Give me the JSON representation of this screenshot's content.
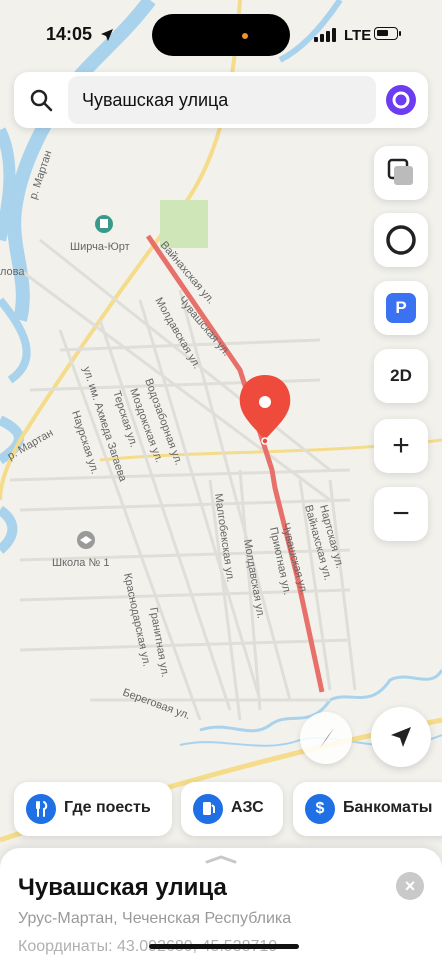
{
  "status_bar": {
    "time": "14:05",
    "network": "LTE"
  },
  "search": {
    "query": "Чувашская улица"
  },
  "map": {
    "poi_village": "Ширча-Юрт",
    "poi_school": "Школа № 1",
    "river_label": "р. Мартан",
    "river_label_2": "р. Мартан",
    "streets": {
      "vainakhskaya_top": "Вайнахская ул.",
      "chuvashskaya_top": "Чувашская ул.",
      "moldavskaya_top": "Молдавская ул.",
      "vodozabornaya": "Водозаборная ул.",
      "mozdokskaya": "Моздокская ул.",
      "terskaya": "Терская ул.",
      "akhmed_zagaev": "ул. им. Ахмеда Загаева",
      "naurskaya": "Наурская ул.",
      "malgobekskaya": "Малгобекская ул.",
      "moldavskaya_bottom": "Молдавская ул.",
      "priyutnaya": "Приютная ул.",
      "chuvashskaya_bottom": "Чувашская ул.",
      "vainakhskaya_bottom": "Вайнахская ул.",
      "nartskaya": "Нартская ул.",
      "krasnodarskaya": "Краснодарская ул.",
      "granitnaya": "Гранитная ул.",
      "beregovaya": "Береговая ул.",
      "partial_left": "лова"
    }
  },
  "controls": {
    "parking": "P",
    "mode": "2D",
    "zoom_in": "+",
    "zoom_out": "−"
  },
  "quick_chips": [
    {
      "label": "Где поесть",
      "icon": "fork-knife-icon"
    },
    {
      "label": "АЗС",
      "icon": "fuel-icon"
    },
    {
      "label": "Банкоматы",
      "icon": "dollar-icon"
    }
  ],
  "sheet": {
    "title": "Чувашская улица",
    "subtitle": "Урус-Мартан, Чеченская Республика",
    "coords": "Координаты: 43.092680, 45.538710"
  },
  "colors": {
    "route": "#e8706a",
    "pin": "#ef4b3c",
    "accent": "#1f6fe5",
    "water": "#a9d3ec"
  }
}
